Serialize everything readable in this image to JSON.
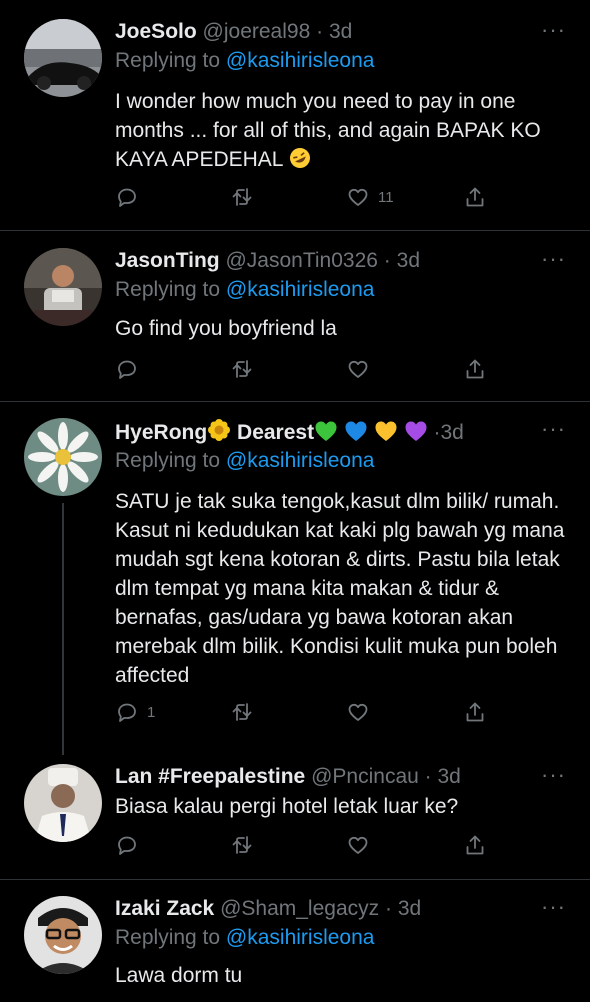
{
  "tweets": [
    {
      "name": "JoeSolo",
      "handle": "@joereal98",
      "time": "3d",
      "replying_label": "Replying to",
      "replying_to": "@kasihirisleona",
      "text": "I wonder how much you need to pay in one months ... for all of this, and again BAPAK KO KAYA APEDEHAL",
      "reply_count": "",
      "retweet_count": "",
      "like_count": "11"
    },
    {
      "name": "JasonTing",
      "handle": "@JasonTin0326",
      "time": "3d",
      "replying_label": "Replying to",
      "replying_to": "@kasihirisleona",
      "text": "Go find you boyfriend la",
      "reply_count": "",
      "retweet_count": "",
      "like_count": ""
    },
    {
      "name_a": "HyeRong",
      "name_b": "Dearest",
      "handle": "",
      "time": "3d",
      "replying_label": "Replying to",
      "replying_to": "@kasihirisleona",
      "text": "SATU je tak suka tengok,kasut dlm bilik/ rumah. Kasut ni kedudukan kat kaki plg bawah yg mana mudah sgt kena kotoran & dirts. Pastu bila letak dlm tempat yg mana kita makan & tidur & bernafas, gas/udara yg bawa kotoran akan merebak dlm bilik. Kondisi kulit muka pun boleh affected",
      "reply_count": "1",
      "retweet_count": "",
      "like_count": ""
    },
    {
      "name": "Lan #Freepalestine",
      "handle": "@Pncincau",
      "time": "3d",
      "text": "Biasa kalau pergi hotel letak luar ke?",
      "reply_count": "",
      "retweet_count": "",
      "like_count": ""
    },
    {
      "name": "Izaki Zack",
      "handle": "@Sham_legacyz",
      "time": "3d",
      "replying_label": "Replying to",
      "replying_to": "@kasihirisleona",
      "text": "Lawa dorm tu"
    }
  ],
  "ui": {
    "dot": "·",
    "more": "···"
  },
  "icons": [
    "reply-icon",
    "retweet-icon",
    "like-icon",
    "share-icon",
    "more-icon"
  ],
  "colors": {
    "background": "#000000",
    "text": "#e7e9ea",
    "muted": "#71767b",
    "link": "#1d9bf0",
    "divider": "#2f3336"
  }
}
